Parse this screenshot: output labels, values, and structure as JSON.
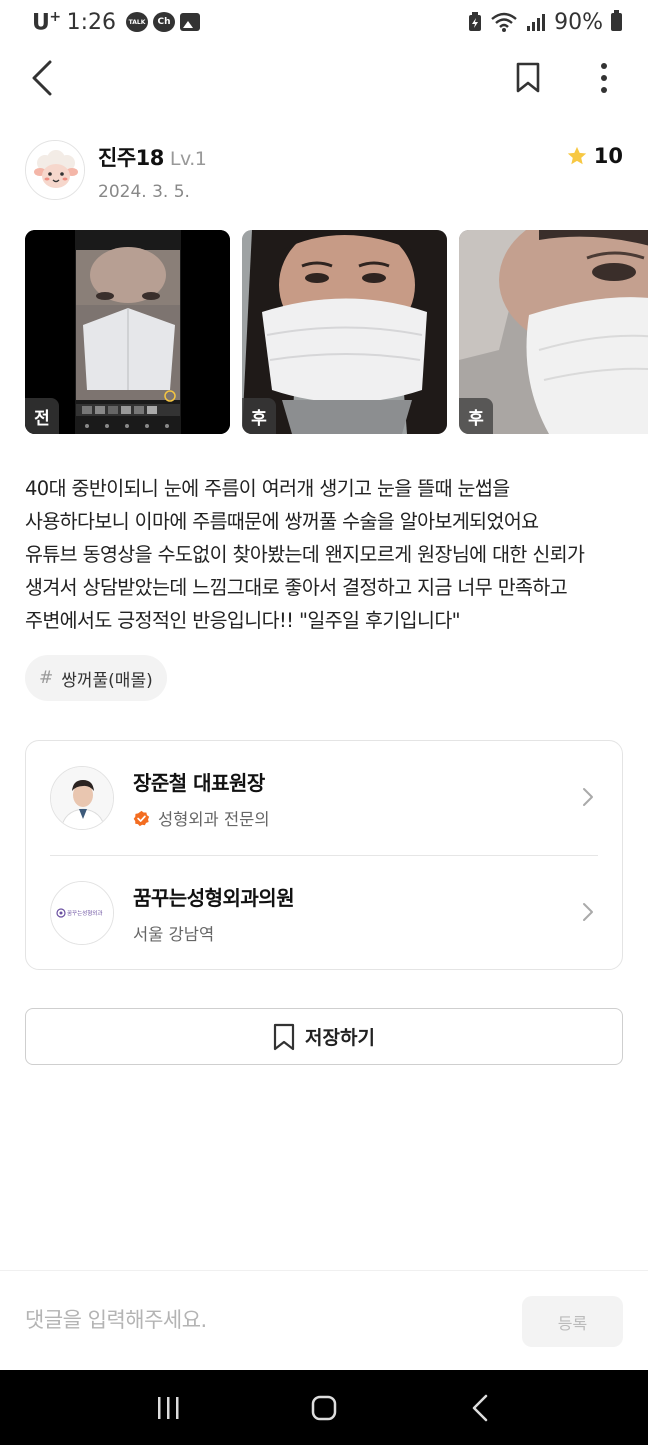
{
  "status_bar": {
    "carrier": "U",
    "carrier_sup": "+",
    "time": "1:26",
    "battery": "90%",
    "icons": [
      "talk-icon",
      "channel-icon",
      "gallery-icon",
      "battery-saver-icon",
      "wifi-icon",
      "signal-icon",
      "battery-icon"
    ],
    "talk_label": "TALK",
    "ch_label": "Ch"
  },
  "header": {
    "icons": [
      "back-icon",
      "bookmark-icon",
      "more-icon"
    ]
  },
  "author": {
    "name": "진주18",
    "level": "Lv.1",
    "date": "2024. 3. 5.",
    "rating": "10"
  },
  "photos": [
    {
      "tag": "전"
    },
    {
      "tag": "후"
    },
    {
      "tag": "후"
    }
  ],
  "review": {
    "text": "40대 중반이되니 눈에 주름이 여러개 생기고 눈을 뜰때 눈썹을\n사용하다보니 이마에 주름때문에 쌍꺼풀 수술을 알아보게되었어요\n유튜브 동영상을 수도없이 찾아봤는데 왠지모르게 원장님에 대한 신뢰가\n생겨서 상담받았는데 느낌그대로 좋아서 결정하고 지금 너무 만족하고\n주변에서도 긍정적인 반응입니다!! \"일주일 후기입니다\""
  },
  "hashtag": {
    "symbol": "#",
    "label": "쌍꺼풀(매몰)"
  },
  "doctor": {
    "name": "장준철 대표원장",
    "specialty": "성형외과 전문의"
  },
  "hospital": {
    "name": "꿈꾸는성형외과의원",
    "location": "서울 강남역",
    "logo_text": "꿈꾸는성형외과"
  },
  "save_button": {
    "label": "저장하기"
  },
  "comment": {
    "placeholder": "댓글을 입력해주세요.",
    "submit_label": "등록"
  },
  "colors": {
    "star": "#f7c843",
    "badge": "#f36d21",
    "photo_tag_bg": "#3c3c3c"
  }
}
